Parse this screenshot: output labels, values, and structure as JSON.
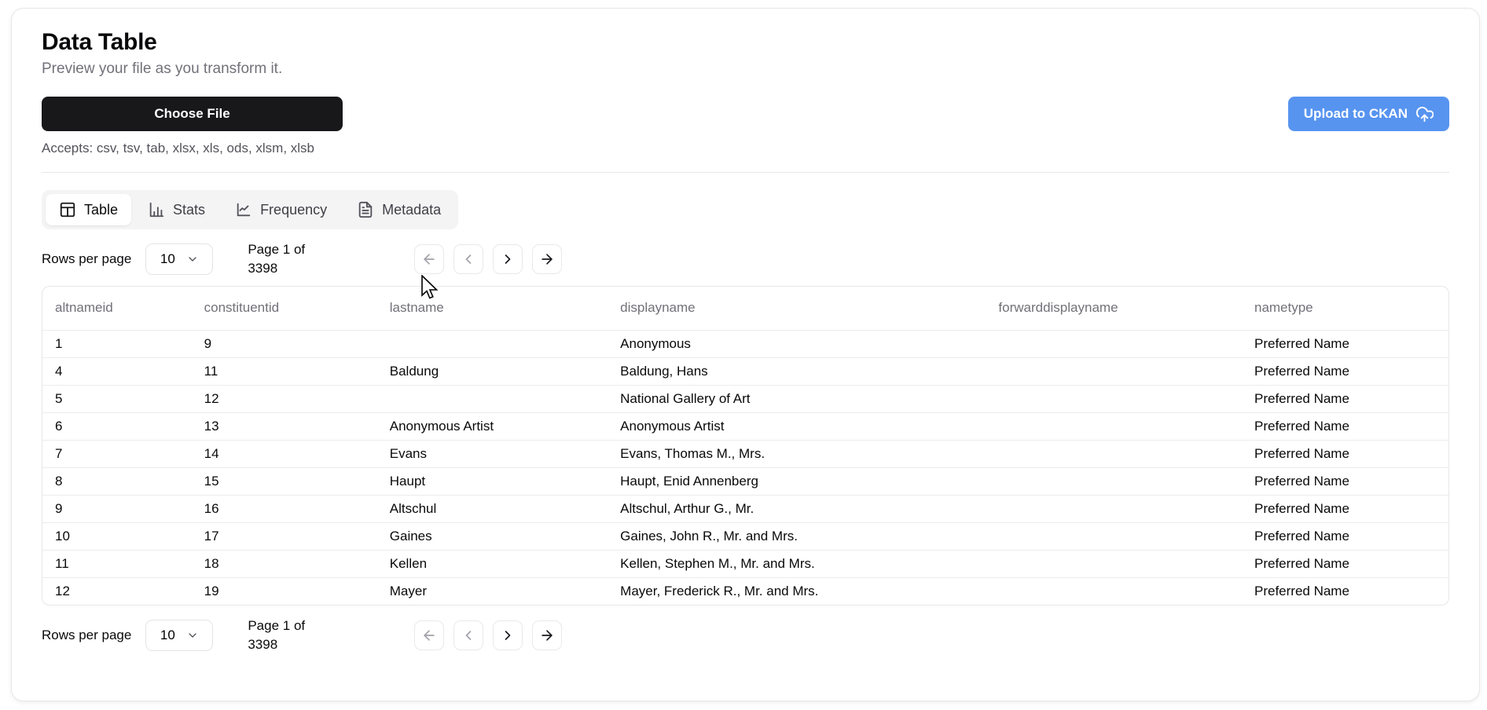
{
  "page": {
    "title": "Data Table",
    "subtitle": "Preview your file as you transform it.",
    "choose_file_label": "Choose File",
    "upload_button_label": "Upload to CKAN",
    "accepts_text": "Accepts: csv, tsv, tab, xlsx, xls, ods, xlsm, xlsb"
  },
  "tabs": [
    {
      "label": "Table",
      "icon": "table-icon",
      "active": true
    },
    {
      "label": "Stats",
      "icon": "bar-chart-icon",
      "active": false
    },
    {
      "label": "Frequency",
      "icon": "line-chart-icon",
      "active": false
    },
    {
      "label": "Metadata",
      "icon": "file-text-icon",
      "active": false
    }
  ],
  "pagination": {
    "rows_per_page_label": "Rows per page",
    "rows_per_page_value": "10",
    "page_status_line1": "Page 1 of",
    "page_status_line2": "3398",
    "nav_icons": [
      "first-page-icon",
      "previous-page-icon",
      "next-page-icon",
      "last-page-icon"
    ],
    "first_disabled": true,
    "previous_disabled": true
  },
  "table": {
    "columns": [
      "altnameid",
      "constituentid",
      "lastname",
      "displayname",
      "forwarddisplayname",
      "nametype"
    ],
    "rows": [
      [
        "1",
        "9",
        "",
        "Anonymous",
        "",
        "Preferred Name"
      ],
      [
        "4",
        "11",
        "Baldung",
        "Baldung, Hans",
        "",
        "Preferred Name"
      ],
      [
        "5",
        "12",
        "",
        "National Gallery of Art",
        "",
        "Preferred Name"
      ],
      [
        "6",
        "13",
        "Anonymous Artist",
        "Anonymous Artist",
        "",
        "Preferred Name"
      ],
      [
        "7",
        "14",
        "Evans",
        "Evans, Thomas M., Mrs.",
        "",
        "Preferred Name"
      ],
      [
        "8",
        "15",
        "Haupt",
        "Haupt, Enid Annenberg",
        "",
        "Preferred Name"
      ],
      [
        "9",
        "16",
        "Altschul",
        "Altschul, Arthur G., Mr.",
        "",
        "Preferred Name"
      ],
      [
        "10",
        "17",
        "Gaines",
        "Gaines, John R., Mr. and Mrs.",
        "",
        "Preferred Name"
      ],
      [
        "11",
        "18",
        "Kellen",
        "Kellen, Stephen M., Mr. and Mrs.",
        "",
        "Preferred Name"
      ],
      [
        "12",
        "19",
        "Mayer",
        "Mayer, Frederick R., Mr. and Mrs.",
        "",
        "Preferred Name"
      ]
    ]
  },
  "colors": {
    "accent_blue": "#5794f0",
    "button_dark": "#18181b",
    "muted_text": "#71717a",
    "border": "#e7e7ea"
  }
}
